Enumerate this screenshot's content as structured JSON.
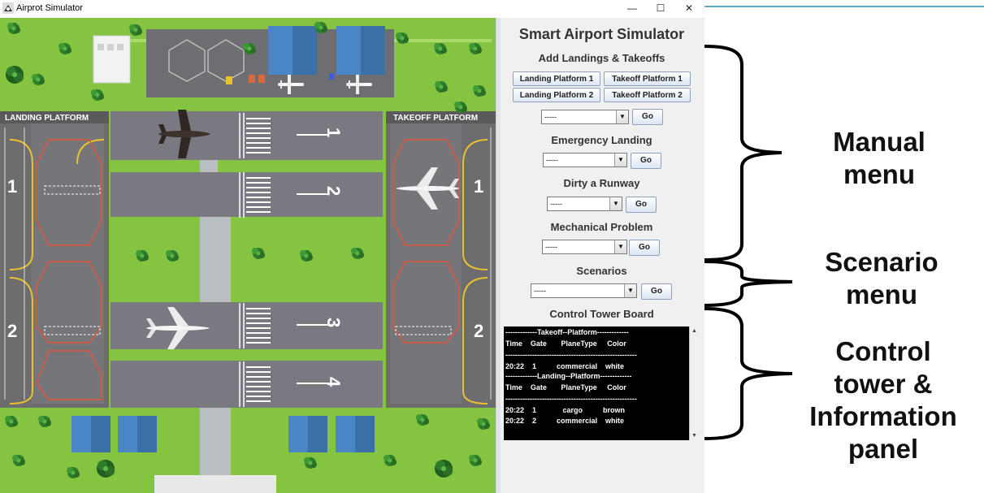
{
  "window": {
    "title": "Airprot Simulator",
    "controls": {
      "minimize": "—",
      "maximize": "☐",
      "close": "✕"
    }
  },
  "map": {
    "landing_platform_label": "LANDING  PLATFORM",
    "takeoff_platform_label": "TAKEOFF  PLATFORM",
    "landing_gates": [
      "1",
      "2"
    ],
    "takeoff_gates": [
      "1",
      "2"
    ],
    "runway_numbers": [
      "1",
      "2",
      "3",
      "4"
    ],
    "colors": {
      "grass": "#84c441",
      "tarmac": "#6b6b6e",
      "runway": "#7a7880",
      "hangar": "#4a86c6",
      "platform_yellow": "#e8c22c",
      "platform_red": "#e0543a"
    }
  },
  "panel": {
    "title": "Smart Airport Simulator",
    "add_heading": "Add Landings & Takeoffs",
    "buttons": {
      "landing1": "Landing Platform 1",
      "takeoff1": "Takeoff Platform 1",
      "landing2": "Landing Platform 2",
      "takeoff2": "Takeoff Platform 2"
    },
    "add_combo_value": "-----",
    "go_label": "Go",
    "emergency_heading": "Emergency Landing",
    "emergency_combo_value": "-----",
    "dirty_heading": "Dirty a Runway",
    "dirty_combo_value": "-----",
    "mechanical_heading": "Mechanical Problem",
    "mechanical_combo_value": "-----",
    "scenarios_heading": "Scenarios",
    "scenarios_combo_value": "-----",
    "board_heading": "Control Tower Board",
    "board_lines": [
      "-------------Takeoff--Platform-------------",
      "Time    Gate       PlaneType     Color",
      "------------------------------------------------------",
      "20:22    1          commercial    white",
      "-------------Landing--Platform-------------",
      "Time    Gate       PlaneType     Color",
      "------------------------------------------------------",
      "20:22    1             cargo          brown",
      "20:22    2          commercial    white"
    ]
  },
  "annotations": {
    "manual": [
      "Manual",
      "menu"
    ],
    "scenario": [
      "Scenario",
      "menu"
    ],
    "control": [
      "Control",
      "tower &",
      "Information",
      "panel"
    ]
  }
}
